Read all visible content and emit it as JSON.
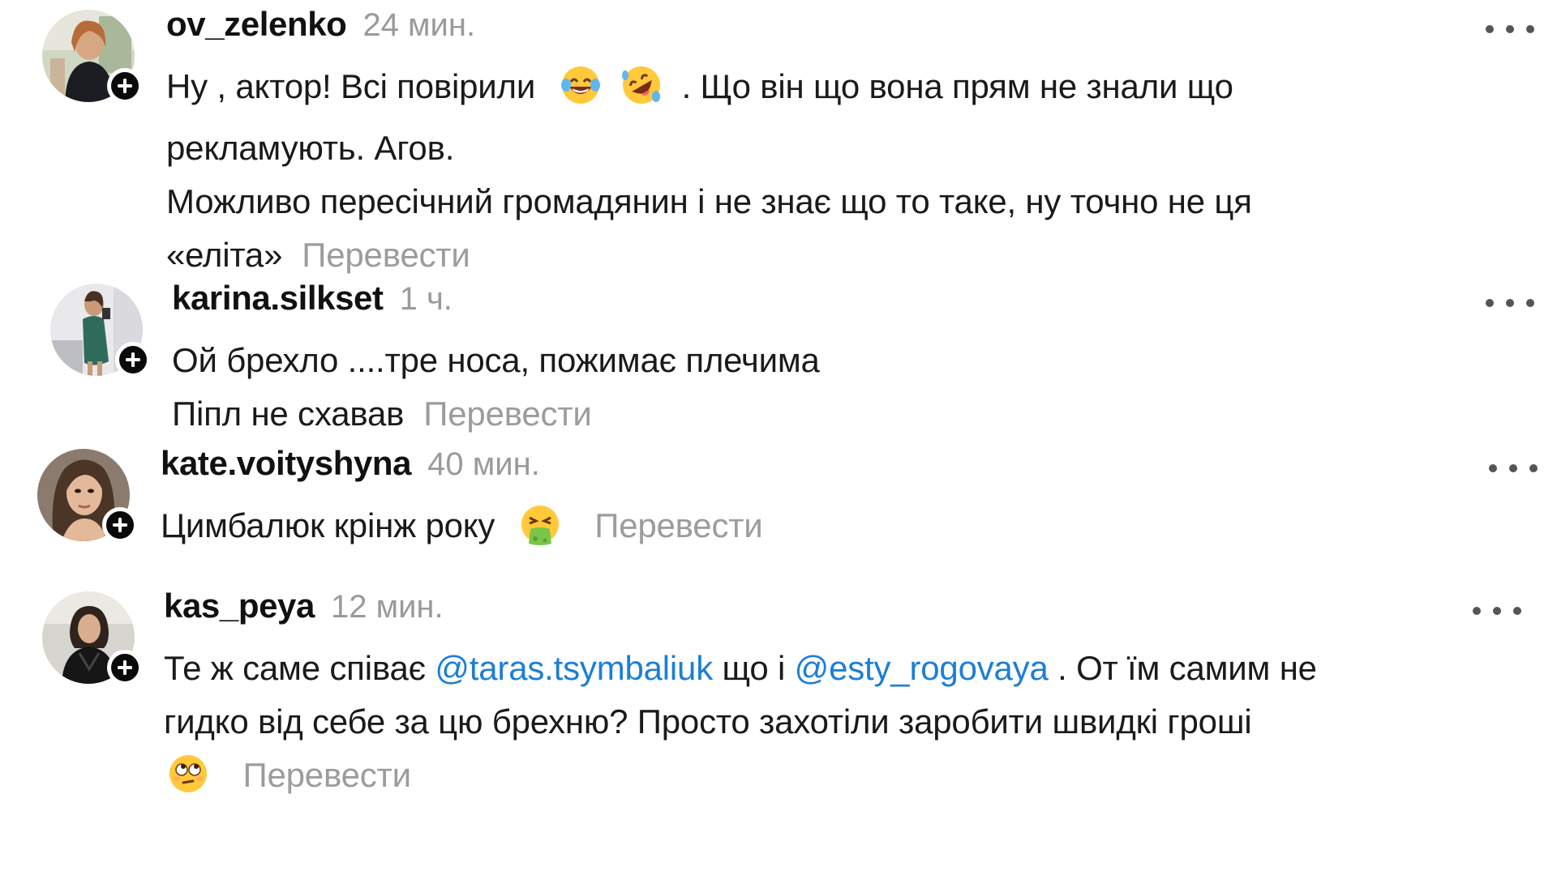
{
  "comments": [
    {
      "username": "ov_zelenko",
      "time": "24 мин.",
      "text_lines": [
        "Ну , актор! Всі повірили",
        ". Що він що вона прям не знали що",
        "рекламують. Агов.",
        "Можливо пересічний громадянин і не знає що то таке, ну точно не ця",
        "«еліта»"
      ],
      "emojis": [
        "tears-of-joy-emoji",
        "rolling-laughing-emoji"
      ],
      "translate": "Перевести"
    },
    {
      "username": "karina.silkset",
      "time": "1 ч.",
      "text_lines": [
        "Ой брехло ....тре носа, пожимає плечима",
        "Піпл не схавав"
      ],
      "translate": "Перевести"
    },
    {
      "username": "kate.voityshyna",
      "time": "40 мин.",
      "text_lines": [
        "Цимбалюк крінж року"
      ],
      "emojis": [
        "vomiting-face-emoji"
      ],
      "translate": "Перевести"
    },
    {
      "username": "kas_peya",
      "time": "12 мин.",
      "text_parts": {
        "before_mention1": "Те ж саме співає",
        "mention1": "@taras.tsymbaliuk",
        "between": "що і",
        "mention2": "@esty_rogovaya",
        "after_mention2": ". От їм самим не",
        "line2": "гидко від себе за цю брехню? Просто захотіли заробити швидкі гроші"
      },
      "emojis": [
        "face-with-rolling-eyes-emoji"
      ],
      "translate": "Перевести"
    }
  ],
  "colors": {
    "username": "#111111",
    "text": "#1a1a1a",
    "muted": "#9a9a9a",
    "mention": "#1c7ed6",
    "badge": "#0a0a0a"
  },
  "icons": [
    "plus-icon",
    "more-options-icon"
  ]
}
